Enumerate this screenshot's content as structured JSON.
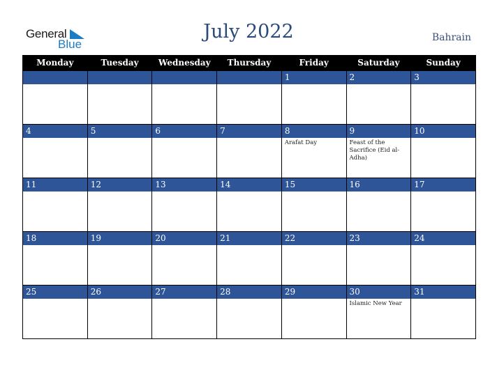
{
  "logo": {
    "general": "General",
    "blue": "Blue",
    "icon": "triangle-flag-icon"
  },
  "title": "July 2022",
  "country": "Bahrain",
  "colors": {
    "header_bg": "#000000",
    "day_bar": "#2d5597",
    "title": "#2b4a7a",
    "logo_blue": "#1b7bc4"
  },
  "weekdays": [
    "Monday",
    "Tuesday",
    "Wednesday",
    "Thursday",
    "Friday",
    "Saturday",
    "Sunday"
  ],
  "weeks": [
    [
      {
        "day": "",
        "event": ""
      },
      {
        "day": "",
        "event": ""
      },
      {
        "day": "",
        "event": ""
      },
      {
        "day": "",
        "event": ""
      },
      {
        "day": "1",
        "event": ""
      },
      {
        "day": "2",
        "event": ""
      },
      {
        "day": "3",
        "event": ""
      }
    ],
    [
      {
        "day": "4",
        "event": ""
      },
      {
        "day": "5",
        "event": ""
      },
      {
        "day": "6",
        "event": ""
      },
      {
        "day": "7",
        "event": ""
      },
      {
        "day": "8",
        "event": "Arafat Day"
      },
      {
        "day": "9",
        "event": "Feast of the Sacrifice (Eid al-Adha)"
      },
      {
        "day": "10",
        "event": ""
      }
    ],
    [
      {
        "day": "11",
        "event": ""
      },
      {
        "day": "12",
        "event": ""
      },
      {
        "day": "13",
        "event": ""
      },
      {
        "day": "14",
        "event": ""
      },
      {
        "day": "15",
        "event": ""
      },
      {
        "day": "16",
        "event": ""
      },
      {
        "day": "17",
        "event": ""
      }
    ],
    [
      {
        "day": "18",
        "event": ""
      },
      {
        "day": "19",
        "event": ""
      },
      {
        "day": "20",
        "event": ""
      },
      {
        "day": "21",
        "event": ""
      },
      {
        "day": "22",
        "event": ""
      },
      {
        "day": "23",
        "event": ""
      },
      {
        "day": "24",
        "event": ""
      }
    ],
    [
      {
        "day": "25",
        "event": ""
      },
      {
        "day": "26",
        "event": ""
      },
      {
        "day": "27",
        "event": ""
      },
      {
        "day": "28",
        "event": ""
      },
      {
        "day": "29",
        "event": ""
      },
      {
        "day": "30",
        "event": "Islamic New Year"
      },
      {
        "day": "31",
        "event": ""
      }
    ]
  ]
}
